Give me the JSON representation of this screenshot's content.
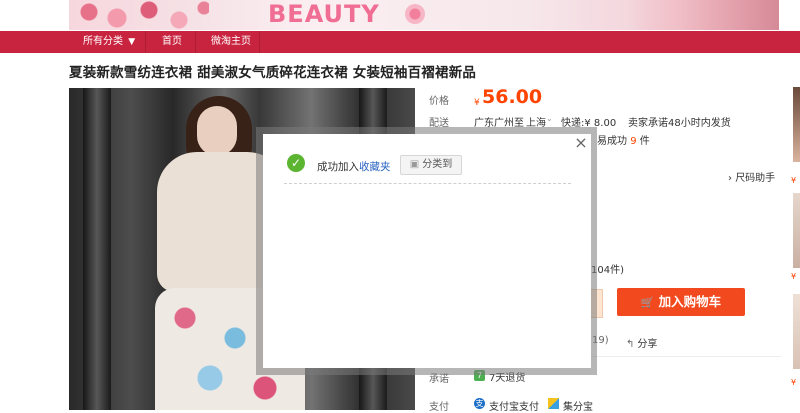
{
  "banner": {
    "headline": "BEAUTY"
  },
  "nav": {
    "items": [
      {
        "label": "所有分类",
        "has_dropdown": true
      },
      {
        "label": "首页"
      },
      {
        "label": "微淘主页"
      }
    ],
    "dropdown_glyph": "▼"
  },
  "product": {
    "title": "夏装新款雪纺连衣裙 甜美淑女气质碎花连衣裙 女装短袖百褶裙新品",
    "price_label": "价格",
    "currency": "¥",
    "price": "56.00",
    "ship_label": "配送",
    "ship_from": "广东广州",
    "ship_to_word": "至",
    "ship_dest": "上海",
    "ship_express": "快递:¥ 8.00",
    "ship_promise": "卖家承诺48小时内发货",
    "sold_prefix": "易成功",
    "sold_count": "9",
    "sold_unit": "件",
    "size_helper": "尺码助手",
    "stock_text": "104件)",
    "cart_button": "加入购物车",
    "collect_count": "19)",
    "share_label": "分享",
    "promise_label": "承诺",
    "promise_text": "7天退货",
    "payment_label": "支付",
    "pay_options": [
      "支付宝支付",
      "集分宝"
    ]
  },
  "dialog": {
    "message_prefix": "成功加入",
    "message_link": "收藏夹",
    "classify_button": "分类到",
    "close_glyph": "×"
  },
  "colors": {
    "nav_red": "#c9243f",
    "price_orange": "#ff4400",
    "cart_button": "#f24a1e",
    "success_green": "#5cb531",
    "link_blue": "#2a63c1"
  },
  "icons": [
    "check-icon",
    "close-icon",
    "cart-icon",
    "share-icon",
    "chat-icon",
    "alipay-icon",
    "jifenbao-icon",
    "dropdown-arrow-icon"
  ]
}
